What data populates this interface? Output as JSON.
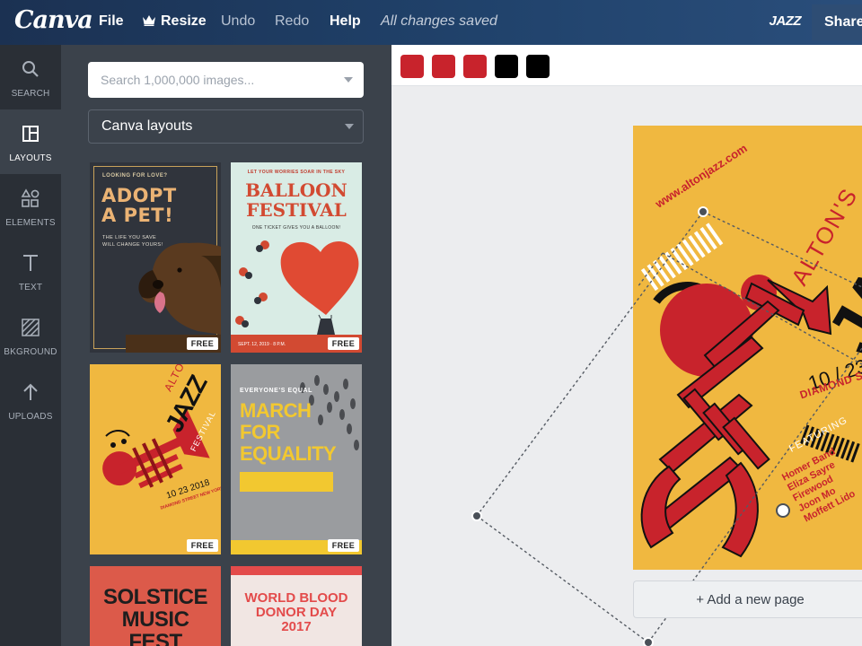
{
  "app": {
    "logo": "Canva",
    "doc_title": "JAZZ",
    "status": "All changes saved"
  },
  "menu": {
    "file": "File",
    "resize": "Resize",
    "undo": "Undo",
    "redo": "Redo",
    "help": "Help",
    "share": "Share"
  },
  "rail": [
    {
      "label": "SEARCH",
      "icon": "search-icon"
    },
    {
      "label": "LAYOUTS",
      "icon": "layouts-icon"
    },
    {
      "label": "ELEMENTS",
      "icon": "elements-icon"
    },
    {
      "label": "TEXT",
      "icon": "text-icon"
    },
    {
      "label": "BKGROUND",
      "icon": "background-icon"
    },
    {
      "label": "UPLOADS",
      "icon": "uploads-icon"
    }
  ],
  "panel": {
    "search_placeholder": "Search 1,000,000 images...",
    "category": "Canva layouts",
    "free_badge": "FREE",
    "templates": {
      "pet": {
        "kicker": "LOOKING FOR LOVE?",
        "title1": "ADOPT",
        "title2": "A PET!",
        "body1": "THE LIFE YOU SAVE",
        "body2": "WILL CHANGE YOURS!"
      },
      "balloon": {
        "kicker": "LET YOUR WORRIES SOAR IN THE SKY",
        "title1": "BALLOON",
        "title2": "FESTIVAL",
        "sub": "ONE TICKET GIVES YOU A BALLOON!"
      },
      "jazz": {
        "title1": "ALTON'S",
        "title2": "JAZZ",
        "title3": "FESTIVAL",
        "date": "10 23 2018",
        "street": "DIAMOND STREET NEW YORK"
      },
      "march": {
        "kicker": "EVERYONE'S EQUAL",
        "title1": "MARCH",
        "title2": "FOR",
        "title3": "EQUALITY"
      },
      "solstice": {
        "title1": "SOLSTICE",
        "title2": "MUSIC",
        "title3": "FEST"
      },
      "blood": {
        "title1": "WORLD BLOOD",
        "title2": "DONOR DAY",
        "year": "2017"
      }
    }
  },
  "palette": [
    "#C8232C",
    "#C8232C",
    "#C8232C",
    "#000000",
    "#000000"
  ],
  "poster": {
    "url": "www.altonjazz.com",
    "title1": "ALTON'S",
    "title2": "JA",
    "date": "10 / 23",
    "street": "DIAMOND STRE",
    "featuring": "FEATURING",
    "bands": [
      "Homer Band",
      "Eliza Sayre",
      "Firewood",
      "Joon Mo",
      "Moffett Lido"
    ]
  },
  "add_page": "+ Add a new page"
}
